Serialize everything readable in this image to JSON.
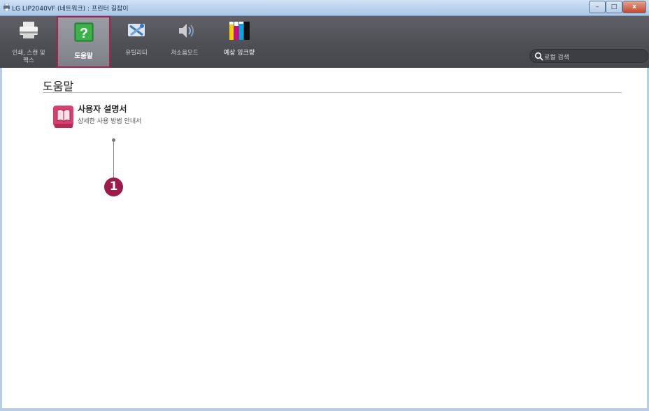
{
  "window": {
    "title": "LG LIP2040VF (네트워크) : 프린터 길잡이",
    "minimize_label": "–",
    "maximize_label": "□",
    "close_label": "x"
  },
  "toolbar": {
    "items": [
      {
        "label_line1": "인쇄, 스캔 및",
        "label_line2": "팩스",
        "icon": "printer-icon"
      },
      {
        "label": "도움말",
        "icon": "help-question-icon",
        "active": true
      },
      {
        "label": "유틸리티",
        "icon": "tools-icon"
      },
      {
        "label": "저소음모드",
        "icon": "speaker-icon"
      },
      {
        "label": "예상 잉크량",
        "icon": "ink-levels-icon"
      }
    ]
  },
  "search": {
    "placeholder": "로컬 검색",
    "icon": "search-icon"
  },
  "main": {
    "section_title": "도움말",
    "manual": {
      "title": "사용자 설명서",
      "subtitle": "상세한 사용 방법 안내서",
      "icon": "manual-book-icon"
    },
    "callout_number": "1"
  },
  "colors": {
    "toolbar_bg": "#4c4e53",
    "active_border": "#a8204e",
    "callout": "#9c1b4b",
    "titlebar": "#a9c6e6"
  }
}
